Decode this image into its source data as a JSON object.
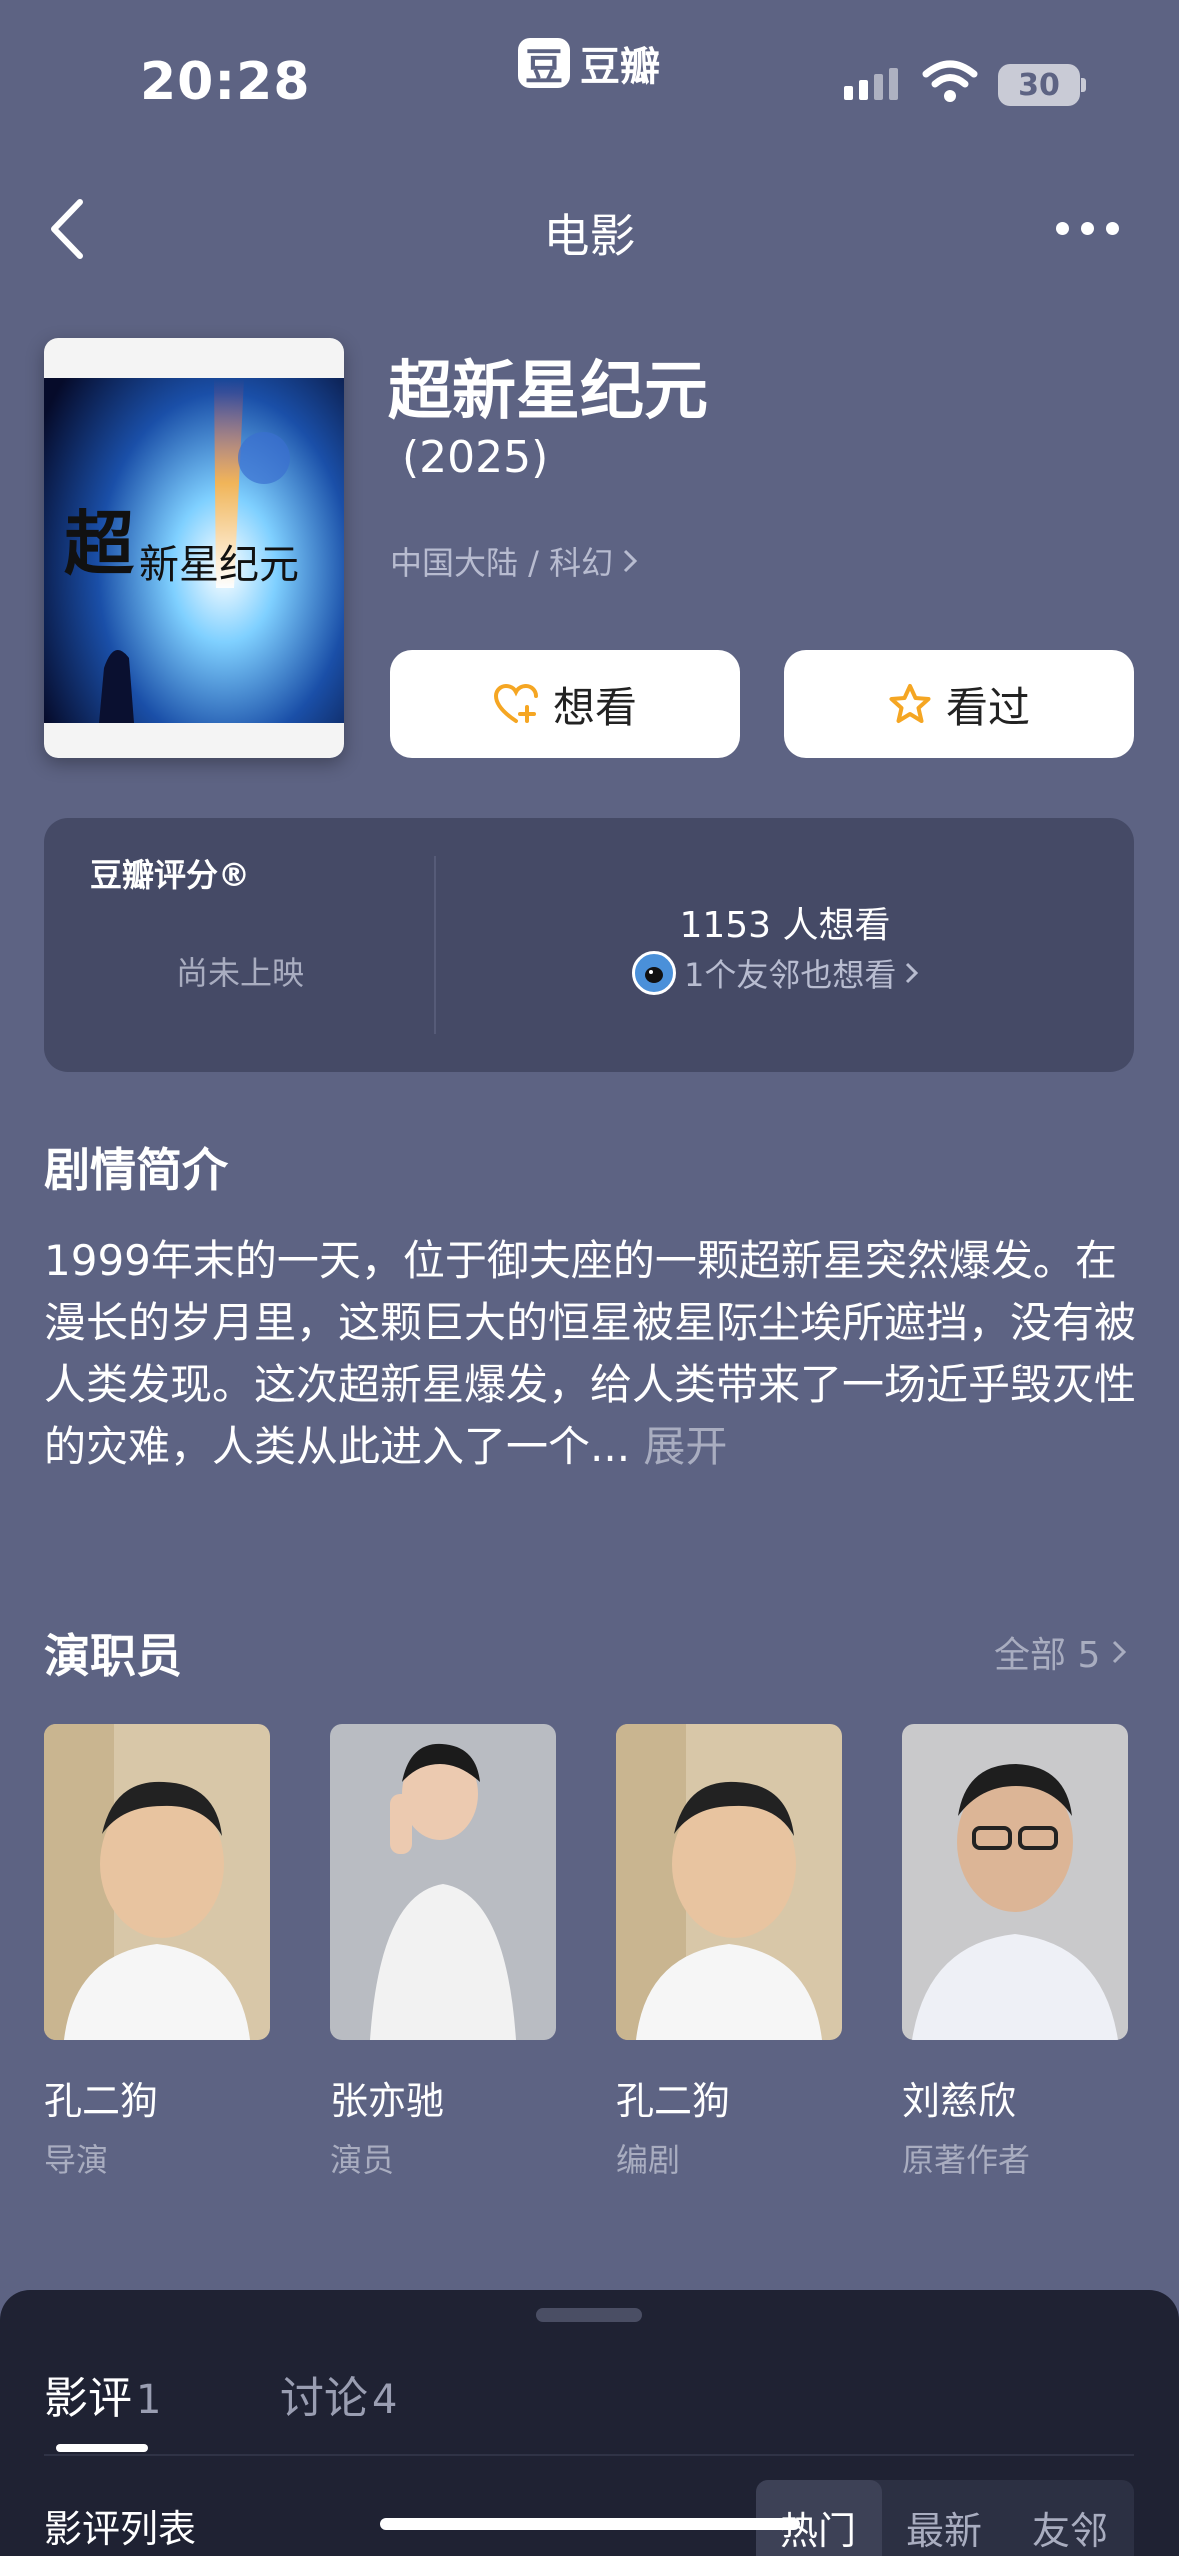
{
  "status_bar": {
    "time": "20:28",
    "app_name": "豆瓣",
    "app_logo_glyph": "豆",
    "battery": "30"
  },
  "nav": {
    "title": "电影"
  },
  "movie": {
    "title": "超新星纪元",
    "year": " (2025)",
    "meta": "中国大陆 / 科幻",
    "want_label": "想看",
    "seen_label": "看过"
  },
  "rating": {
    "label": "豆瓣评分®",
    "status": "尚未上映",
    "want_count": "1153 人想看",
    "friends": "1个友邻也想看"
  },
  "synopsis": {
    "heading": "剧情简介",
    "text": "1999年末的一天，位于御夫座的一颗超新星突然爆发。在漫长的岁月里，这颗巨大的恒星被星际尘埃所遮挡，没有被人类发现。这次超新星爆发，给人类带来了一场近乎毁灭性的灾难，人类从此进入了一个... ",
    "more": "展开"
  },
  "cast": {
    "heading": "演职员",
    "all_label": "全部 5",
    "members": [
      {
        "name": "孔二狗",
        "role": "导演"
      },
      {
        "name": "张亦驰",
        "role": "演员"
      },
      {
        "name": "孔二狗",
        "role": "编剧"
      },
      {
        "name": "刘慈欣",
        "role": "原著作者"
      }
    ]
  },
  "bottom_sheet": {
    "tab_reviews": "影评",
    "tab_reviews_count": "1",
    "tab_discussion": "讨论",
    "tab_discussion_count": "4",
    "list_label": "影评列表",
    "filters": [
      "热门",
      "最新",
      "友邻"
    ]
  },
  "colors": {
    "background": "#5d6383",
    "card": "#454a66",
    "sheet": "#1f2233",
    "accent_orange": "#f5a623"
  }
}
